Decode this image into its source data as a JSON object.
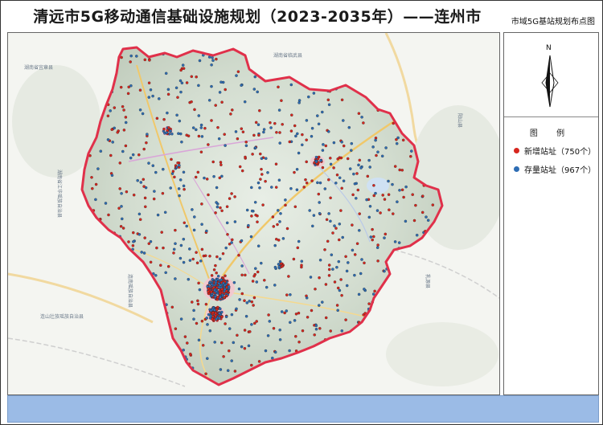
{
  "title": "清远市5G移动通信基础设施规划（2023-2035年）——连州市",
  "subtitle": "市域5G基站规划布点图",
  "compass": {
    "letter": "N",
    "icon": "north-arrow-icon"
  },
  "legend": {
    "title": "图 例",
    "items": [
      {
        "label": "新增站址（750个）",
        "color": "#d7261e"
      },
      {
        "label": "存量站址（967个）",
        "color": "#2e6db4"
      }
    ]
  },
  "map": {
    "boundary_color": "#e0304a",
    "new_site_color": "#d7261e",
    "existing_site_color": "#2e6db4",
    "labels": [
      "湖南省临武县",
      "湖南省宜章县",
      "湖南省江华瑶族自治县",
      "阳山县",
      "连山壮族瑶族自治县",
      "连南瑶族自治县",
      "乳源县"
    ]
  }
}
